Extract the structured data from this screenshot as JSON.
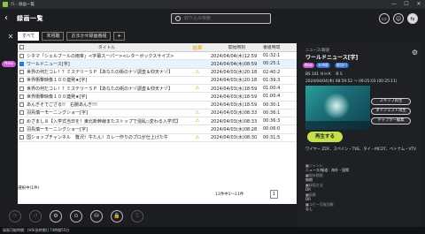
{
  "window": {
    "title": "ﾅｽ - 録画一覧",
    "minimize": "—",
    "maximize": "☐",
    "close": "✕"
  },
  "header": {
    "back_glyph": "‹",
    "page_title": "録画一覧",
    "search_placeholder": "絞り込み検索",
    "icons": [
      "tv-icon",
      "person-icon",
      "toggle-icon"
    ]
  },
  "tabs": [
    "すべて",
    "未視聴",
    "おまかせ録画番組",
    "+"
  ],
  "table": {
    "headers": {
      "title": "タイトル",
      "result": "結果",
      "start": "開始時刻",
      "length": "番組時間"
    },
    "rows": [
      {
        "title": "シネマ「シェルブールの雨傘」<字幕スーパー><レターボックスサイズ>",
        "result": "",
        "start": "2024/04/04(木)12:59",
        "length": "01:32:1",
        "checked": false,
        "new": false,
        "selected": false
      },
      {
        "title": "ワールドニュース[字]",
        "result": "",
        "start": "2024/04/04(木)08:59",
        "length": "00:25:1",
        "checked": true,
        "new": true,
        "selected": true
      },
      {
        "title": "世界の何だコレ！？ミステリーＳＰ【あなたの街のナゾ調査＆仰天ナゾ】",
        "result": "⚠",
        "start": "2024/04/03(水)20:18",
        "length": "02:40:2",
        "checked": false,
        "new": false,
        "selected": false
      },
      {
        "title": "世界衝撃映像１００連発★[字]",
        "result": "",
        "start": "2024/04/03(水)20:18",
        "length": "01:39:3",
        "checked": false,
        "new": false,
        "selected": false
      },
      {
        "title": "世界の何だコレ！？ミステリーＳＰ【あなたの街のナゾ調査＆仰天ナゾ】",
        "result": "⚠",
        "start": "2024/04/03(水)18:59",
        "length": "01:00:4",
        "checked": false,
        "new": false,
        "selected": false
      },
      {
        "title": "世界衝撃映像１００連発★[字]",
        "result": "",
        "start": "2024/04/03(水)18:59",
        "length": "01:00:4",
        "checked": false,
        "new": false,
        "selected": false
      },
      {
        "title": "あんぎそでござる!!　右腕あんぎ!!!",
        "result": "",
        "start": "2024/04/03(水)18:59",
        "length": "00:30:1",
        "checked": false,
        "new": false,
        "selected": false
      },
      {
        "title": "羽鳥慎一モーニングショー[字]",
        "result": "⚠",
        "start": "2024/04/03(水)08:33",
        "length": "00:36:1",
        "checked": false,
        "new": false,
        "selected": false
      },
      {
        "title": "めざまし８【入学式当日を！東北新幹線またストップで混乱◇変わる入学式】",
        "result": "⚠",
        "start": "2024/04/03(水)08:33",
        "length": "00:36:3",
        "checked": false,
        "new": false,
        "selected": false
      },
      {
        "title": "羽鳥慎一モーニングショー[字]",
        "result": "",
        "start": "2024/04/03(水)08:28",
        "length": "00:06:0",
        "checked": false,
        "new": false,
        "selected": false
      },
      {
        "title": "国ショップチャンネル　贅沢！牛たん！カレー作りのプロが仕上げた牛",
        "result": "⚠",
        "start": "2024/04/03(水)08:30",
        "length": "00:31:5",
        "checked": false,
        "new": false,
        "selected": false
      }
    ],
    "selected_count": "選択中(1件)",
    "pager": "11件中1〜11件",
    "page": "1"
  },
  "detail": {
    "genre_label": "ニュース/報道",
    "title": "ワールドニュース[字]",
    "badges": [
      "New",
      "未視聴",
      "解説付"
    ],
    "channel": "BS 101 ＮＨＫ　ＢＳ",
    "airtime": "2024/04/04(木) 08:59:52 〜 09:25:03 (00:25:11)",
    "buttons": {
      "skip": "スキップ再生",
      "digest": "ダイジェスト再生",
      "chapter": "チャプター編集"
    },
    "play": "再生する",
    "description": "ワイヤー ZDF、スペイン・TVE、タイ・MCOT、ベトナム・VTV",
    "meta": [
      {
        "k": "■ジャンル",
        "v": "ニュース/報道：海外・国際"
      },
      {
        "k": "■保存期限",
        "v": "無期"
      },
      {
        "k": "■録画方法",
        "v": "DR"
      },
      {
        "k": "■画質",
        "v": "DR"
      },
      {
        "k": "■コピー可能回数",
        "v": "なし"
      }
    ]
  },
  "toolbar": [
    "⟳",
    "↺",
    "⚙",
    "⊙",
    "⛁",
    "🔒",
    "⚿"
  ],
  "status": "録画可能時間：[HS(長時間)] 74時間55分"
}
